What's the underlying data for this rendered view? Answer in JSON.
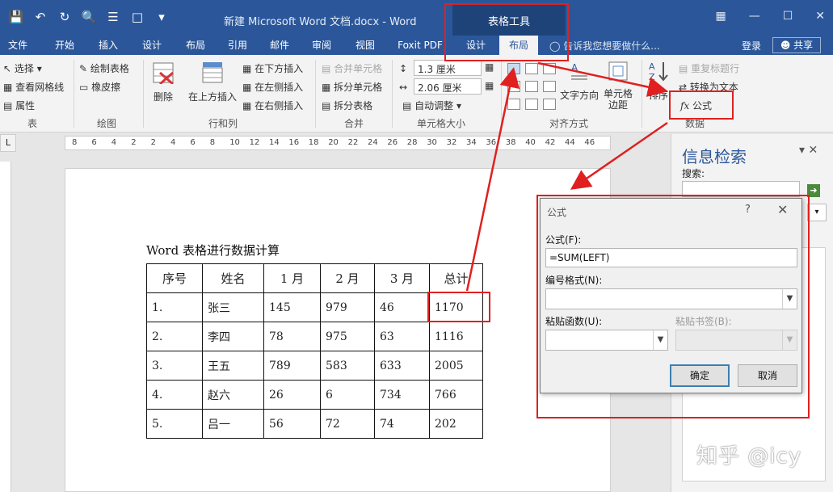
{
  "window": {
    "doc_title": "新建 Microsoft Word 文档.docx - Word",
    "contextual_tab_group": "表格工具",
    "qat_icons": [
      "save-icon",
      "undo-icon",
      "redo-icon",
      "print-preview-icon",
      "list-icon",
      "touch-mode-icon",
      "customize-icon"
    ]
  },
  "tabs": [
    {
      "label": "文件"
    },
    {
      "label": "开始"
    },
    {
      "label": "插入"
    },
    {
      "label": "设计"
    },
    {
      "label": "布局"
    },
    {
      "label": "引用"
    },
    {
      "label": "邮件"
    },
    {
      "label": "审阅"
    },
    {
      "label": "视图"
    },
    {
      "label": "Foxit PDF"
    },
    {
      "label": "设计"
    },
    {
      "label": "布局"
    }
  ],
  "tell_me": "告诉我您想要做什么...",
  "account": {
    "login": "登录",
    "share": "共享"
  },
  "ribbon": {
    "table": {
      "select": "选择",
      "gridlines": "查看网格线",
      "properties": "属性",
      "group": "表"
    },
    "draw": {
      "draw_table": "绘制表格",
      "eraser": "橡皮擦",
      "group": "绘图"
    },
    "rows_cols": {
      "delete": "删除",
      "insert_above": "在上方插入",
      "insert_below": "在下方插入",
      "insert_left": "在左侧插入",
      "insert_right": "在右侧插入",
      "group": "行和列"
    },
    "merge": {
      "merge_cells": "合并单元格",
      "split_cells": "拆分单元格",
      "split_table": "拆分表格",
      "group": "合并"
    },
    "cell_size": {
      "height": "1.3 厘米",
      "width": "2.06 厘米",
      "autofit": "自动调整",
      "group": "单元格大小"
    },
    "alignment": {
      "text_direction": "文字方向",
      "cell_margins": "单元格边距",
      "group": "对齐方式"
    },
    "data": {
      "sort": "排序",
      "repeat_header": "重复标题行",
      "convert_text": "转换为文本",
      "formula": "公式",
      "group": "数据"
    }
  },
  "ruler": {
    "marks": [
      "8",
      "6",
      "4",
      "2",
      "2",
      "4",
      "6",
      "8",
      "10",
      "12",
      "14",
      "16",
      "18",
      "20",
      "22",
      "24",
      "26",
      "28",
      "30",
      "32",
      "34",
      "36",
      "38",
      "40",
      "42",
      "44",
      "46"
    ]
  },
  "document": {
    "heading": "Word 表格进行数据计算",
    "table": {
      "headers": [
        "序号",
        "姓名",
        "1 月",
        "2 月",
        "3 月",
        "总计"
      ],
      "rows": [
        [
          "1.",
          "张三",
          "145",
          "979",
          "46",
          "1170"
        ],
        [
          "2.",
          "李四",
          "78",
          "975",
          "63",
          "1116"
        ],
        [
          "3.",
          "王五",
          "789",
          "583",
          "633",
          "2005"
        ],
        [
          "4.",
          "赵六",
          "26",
          "6",
          "734",
          "766"
        ],
        [
          "5.",
          "吕一",
          "56",
          "72",
          "74",
          "202"
        ]
      ]
    }
  },
  "task_pane": {
    "title": "信息检索",
    "search_label": "搜索:"
  },
  "dialog": {
    "title": "公式",
    "help": "?",
    "formula_label": "公式(F):",
    "formula_value": "=SUM(LEFT)",
    "number_format_label": "编号格式(N):",
    "paste_function_label": "粘贴函数(U):",
    "paste_bookmark_label": "粘贴书签(B):",
    "ok": "确定",
    "cancel": "取消"
  },
  "watermark": "知乎 @icy",
  "colors": {
    "accent": "#2b579a",
    "annotation": "#e02020"
  }
}
